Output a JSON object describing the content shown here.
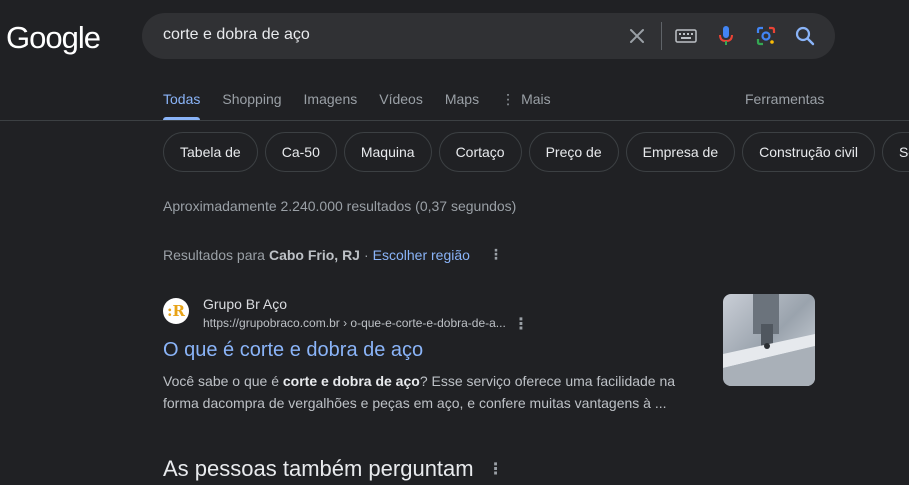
{
  "logo": "Google",
  "search": {
    "query": "corte e dobra de aço"
  },
  "tabs": [
    {
      "label": "Todas",
      "active": true
    },
    {
      "label": "Shopping",
      "active": false
    },
    {
      "label": "Imagens",
      "active": false
    },
    {
      "label": "Vídeos",
      "active": false
    },
    {
      "label": "Maps",
      "active": false
    },
    {
      "label": "Mais",
      "active": false
    }
  ],
  "tools_label": "Ferramentas",
  "chips": [
    "Tabela de",
    "Ca-50",
    "Maquina",
    "Cortaço",
    "Preço de",
    "Empresa de",
    "Construção civil",
    "So"
  ],
  "stats": "Aproximadamente 2.240.000 resultados (0,37 segundos)",
  "location": {
    "prefix": "Resultados para",
    "place": "Cabo Frio, RJ",
    "separator": "·",
    "link": "Escolher região"
  },
  "result": {
    "favicon_text": ":R",
    "site_name": "Grupo Br Aço",
    "url": "https://grupobraco.com.br › o-que-e-corte-e-dobra-de-a...",
    "title": "O que é corte e dobra de aço",
    "snippet_pre": "Você sabe o que é ",
    "snippet_bold": "corte e dobra de aço",
    "snippet_post": "? Esse serviço oferece uma facilidade na forma dacompra de vergalhões e peças em aço, e confere muitas vantagens à ..."
  },
  "paa_title": "As pessoas também perguntam",
  "colors": {
    "background": "#202124",
    "link": "#8ab4f8",
    "searchbox": "#303134"
  }
}
